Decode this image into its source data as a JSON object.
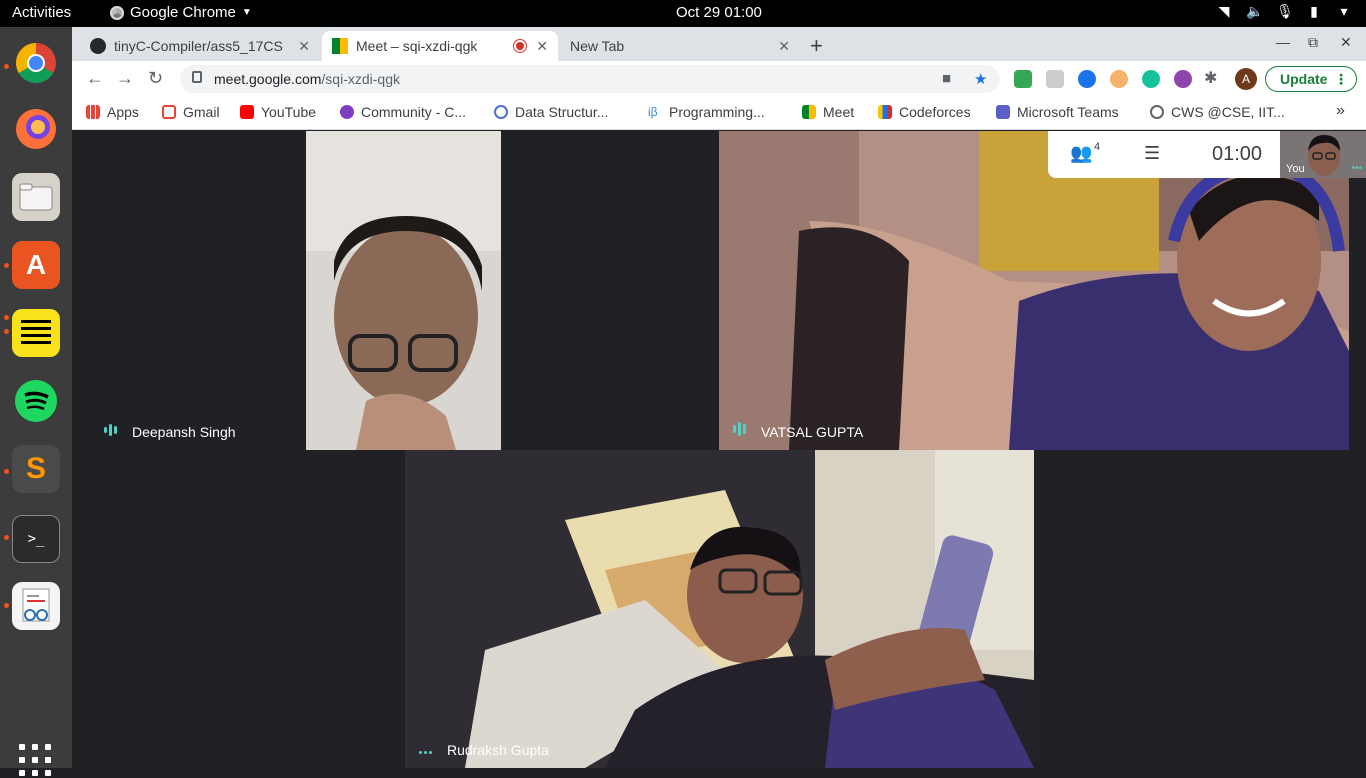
{
  "topbar": {
    "activities": "Activities",
    "app_name": "Google Chrome",
    "clock": "Oct 29  01:00"
  },
  "browser": {
    "tabs": [
      {
        "label": "tinyC-Compiler/ass5_17CS",
        "icon": "github-icon"
      },
      {
        "label": "Meet – sqi-xzdi-qgk",
        "icon": "meet-icon",
        "recording": true
      },
      {
        "label": "New Tab",
        "icon": "none"
      }
    ],
    "url_host": "meet.google.com",
    "url_path": "/sqi-xzdi-qgk",
    "update_label": "Update",
    "avatar_initial": "A",
    "bookmarks": [
      {
        "label": "Apps",
        "icon": "apps-grid-icon"
      },
      {
        "label": "Gmail",
        "icon": "gmail-icon"
      },
      {
        "label": "YouTube",
        "icon": "youtube-icon"
      },
      {
        "label": "Community - C...",
        "icon": "community-icon"
      },
      {
        "label": "Data Structur...",
        "icon": "data-structures-icon"
      },
      {
        "label": "Programming...",
        "icon": "interviewbit-icon"
      },
      {
        "label": "Meet",
        "icon": "meet-icon"
      },
      {
        "label": "Codeforces",
        "icon": "codeforces-icon"
      },
      {
        "label": "Microsoft Teams",
        "icon": "teams-icon"
      },
      {
        "label": "CWS @CSE, IIT...",
        "icon": "globe-icon"
      }
    ],
    "bookmarks_more": "»"
  },
  "meet": {
    "participant_count": "4",
    "timer": "01:00",
    "self_label": "You",
    "participants": [
      {
        "name": "Deepansh Singh"
      },
      {
        "name": "VATSAL GUPTA"
      },
      {
        "name": "Rudraksh Gupta"
      }
    ]
  },
  "colors": {
    "accent_green": "#188038",
    "audio_indicator": "#4fd1c5",
    "meet_background": "#202124"
  }
}
